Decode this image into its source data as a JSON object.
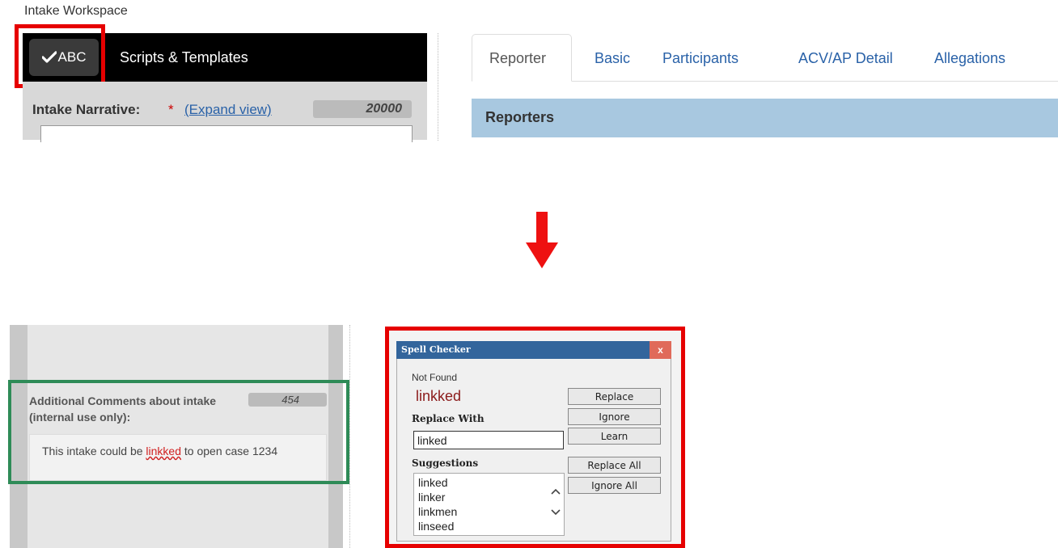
{
  "top": {
    "workspace_title": "Intake Workspace",
    "toolbar": {
      "spellcheck_label": "ABC",
      "scripts_label": "Scripts & Templates"
    },
    "narrative": {
      "label": "Intake Narrative:",
      "required_mark": "*",
      "expand_link": "(Expand view)",
      "char_count": "20000"
    },
    "tabs": [
      {
        "label": "Reporter",
        "active": true
      },
      {
        "label": "Basic"
      },
      {
        "label": "Participants"
      },
      {
        "label": "ACV/AP Detail"
      },
      {
        "label": "Allegations"
      }
    ],
    "section_header": "Reporters"
  },
  "bottom": {
    "comments": {
      "label": "Additional Comments about intake (internal use only):",
      "char_count": "454",
      "text_before": "This intake could be",
      "misspelled_word": "linkked",
      "text_after": "to open case 1234"
    },
    "spell_checker": {
      "title": "Spell Checker",
      "close_label": "x",
      "not_found_label": "Not Found",
      "not_found_word": "linkked",
      "replace_with_label": "Replace With",
      "replace_with_value": "linked",
      "suggestions_label": "Suggestions",
      "suggestions": [
        "linked",
        "linker",
        "linkmen",
        "linseed"
      ],
      "buttons": {
        "replace": "Replace",
        "ignore": "Ignore",
        "learn": "Learn",
        "replace_all": "Replace All",
        "ignore_all": "Ignore All"
      }
    }
  },
  "colors": {
    "highlight_red": "#e60000",
    "highlight_green": "#2e8b57",
    "arrow_red": "#ee1111",
    "titlebar_blue": "#33659c",
    "section_blue": "#a8c8e0"
  }
}
